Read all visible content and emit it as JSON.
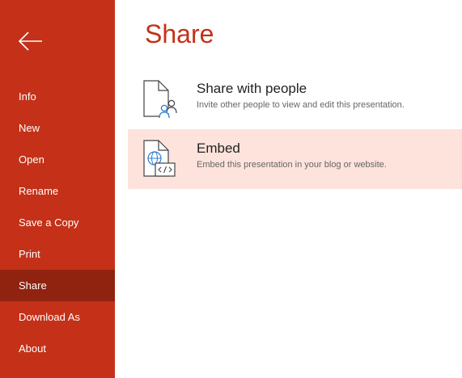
{
  "sidebar": {
    "back_icon": "arrow-left-icon",
    "items": [
      {
        "label": "Info"
      },
      {
        "label": "New"
      },
      {
        "label": "Open"
      },
      {
        "label": "Rename"
      },
      {
        "label": "Save a Copy"
      },
      {
        "label": "Print"
      },
      {
        "label": "Share",
        "active": true
      },
      {
        "label": "Download As"
      },
      {
        "label": "About"
      }
    ]
  },
  "main": {
    "title": "Share",
    "options": [
      {
        "title": "Share with people",
        "description": "Invite other people to view and edit this presentation.",
        "icon": "share-with-people-icon",
        "selected": false
      },
      {
        "title": "Embed",
        "description": "Embed this presentation in your blog or website.",
        "icon": "embed-icon",
        "selected": true
      }
    ]
  },
  "colors": {
    "brand_red": "#c43118",
    "active_nav": "#8f2310",
    "selected_bg": "#fde3dc",
    "icon_blue": "#2b7cd3"
  }
}
